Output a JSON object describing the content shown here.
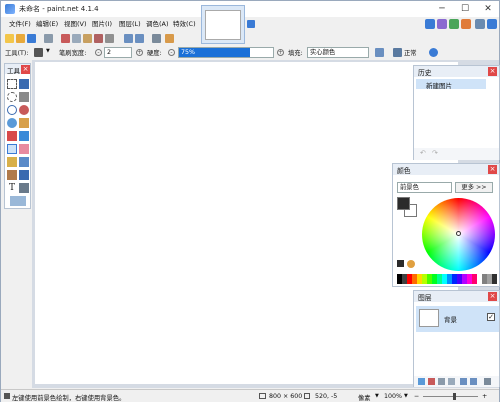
{
  "window": {
    "title": "未命名 - paint.net 4.1.4"
  },
  "menu": [
    "文件(F)",
    "编辑(E)",
    "视图(V)",
    "图片(I)",
    "图层(L)",
    "调色(A)",
    "特效(C)"
  ],
  "options": {
    "tool_label": "工具(T):",
    "brush_width_label": "笔刷宽度:",
    "brush_width_value": "2",
    "hardness_label": "硬度:",
    "hardness_value": "75%",
    "hardness_fraction": 0.75,
    "fill_label": "填充:",
    "fill_value": "实心颜色",
    "blend_mode": "正常"
  },
  "tools_panel": {
    "title": "工具"
  },
  "history_panel": {
    "title": "历史",
    "items": [
      "新建图片"
    ]
  },
  "colors_panel": {
    "title": "颜色",
    "select_value": "前景色",
    "more_button": "更多 >>",
    "primary_color": "#2b2b2b",
    "secondary_color": "#ffffff"
  },
  "layers_panel": {
    "title": "图层",
    "layers": [
      "背景"
    ]
  },
  "status": {
    "hint": "左键使用前景色绘制，右键使用背景色。",
    "image_size": "800 × 600",
    "cursor_pos": "520, -5",
    "unit": "像素",
    "zoom": "100%"
  }
}
